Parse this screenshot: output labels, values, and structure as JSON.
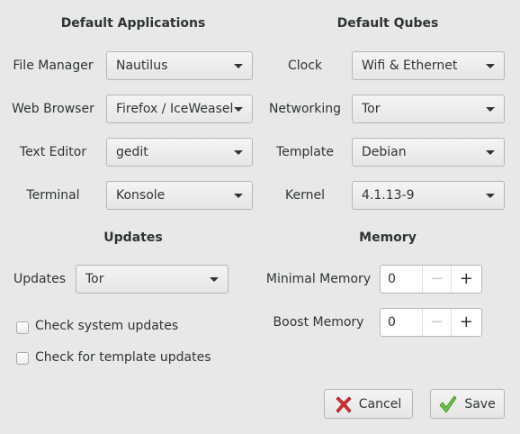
{
  "default_applications": {
    "heading": "Default Applications",
    "rows": [
      {
        "label": "File Manager",
        "value": "Nautilus"
      },
      {
        "label": "Web Browser",
        "value": "Firefox / IceWeasel"
      },
      {
        "label": "Text Editor",
        "value": "gedit"
      },
      {
        "label": "Terminal",
        "value": "Konsole"
      }
    ]
  },
  "default_qubes": {
    "heading": "Default Qubes",
    "rows": [
      {
        "label": "Clock",
        "value": "Wifi & Ethernet"
      },
      {
        "label": "Networking",
        "value": "Tor"
      },
      {
        "label": "Template",
        "value": "Debian"
      },
      {
        "label": "Kernel",
        "value": "4.1.13-9"
      }
    ]
  },
  "updates": {
    "heading": "Updates",
    "label": "Updates",
    "value": "Tor",
    "check_system": {
      "label": "Check system updates",
      "checked": false
    },
    "check_template": {
      "label": "Check for template updates",
      "checked": false
    }
  },
  "memory": {
    "heading": "Memory",
    "minimal": {
      "label": "Minimal Memory",
      "value": "0"
    },
    "boost": {
      "label": "Boost Memory",
      "value": "0"
    },
    "minus": "−",
    "plus": "+"
  },
  "buttons": {
    "cancel": "Cancel",
    "save": "Save"
  },
  "colors": {
    "cancel_icon": "#e03030",
    "save_icon": "#6cc24a"
  }
}
